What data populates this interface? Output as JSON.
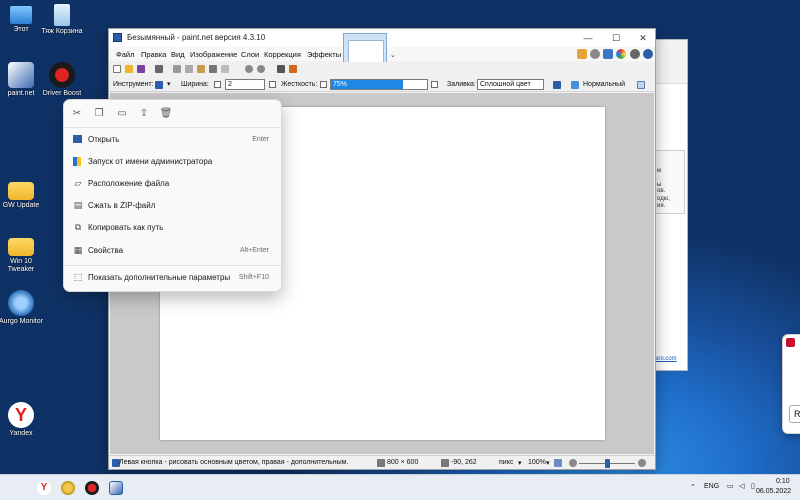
{
  "desktop": {
    "icons": [
      {
        "label": "Этот",
        "icon": "computer-icon"
      },
      {
        "label": "Тяж Корзина",
        "icon": "recycle-bin-icon"
      },
      {
        "label": "paint.net",
        "icon": "paintnet-icon"
      },
      {
        "label": "Driver Boost",
        "icon": "driver-booster-icon"
      },
      {
        "label": "GW Update",
        "icon": "folder-icon"
      },
      {
        "label": "Win 10 Tweaker",
        "icon": "folder-icon"
      },
      {
        "label": "Aurgo Monitor",
        "icon": "monitor-app-icon"
      },
      {
        "label": "Yandex",
        "icon": "yandex-browser-icon"
      }
    ]
  },
  "background_window": {
    "lines": [
      "м",
      "ы",
      "ов.",
      "одю,",
      "ия."
    ],
    "link": "aro.com"
  },
  "paintnet": {
    "title": "Безымянный - paint.net версия 4.3.10",
    "menu": [
      "Файл",
      "Правка",
      "Вид",
      "Изображение",
      "Слои",
      "Коррекция",
      "Эффекты"
    ],
    "toolbar": {
      "tool_label": "Инструмент:",
      "width_label": "Ширина:",
      "width_value": "2",
      "hardness_label": "Жесткость:",
      "hardness_value": "75%",
      "hardness_level": 0.75,
      "fill_label": "Заливка:",
      "fill_value": "Сплошной цвет",
      "blend_value": "Нормальный"
    },
    "status": {
      "hint": "Левая кнопка - рисовать основным цветом, правая - дополнительным.",
      "size": "800 × 600",
      "coords": "-90, 262",
      "units": "пикс",
      "zoom": "100%"
    }
  },
  "context_menu": {
    "quick_actions": [
      {
        "name": "cut",
        "icon": "cut-icon"
      },
      {
        "name": "copy",
        "icon": "copy-icon"
      },
      {
        "name": "rename",
        "icon": "rename-icon"
      },
      {
        "name": "share",
        "icon": "share-icon"
      },
      {
        "name": "delete",
        "icon": "delete-icon"
      }
    ],
    "items": [
      {
        "label": "Открыть",
        "shortcut": "Enter",
        "icon": "open-icon"
      },
      {
        "label": "Запуск от имени администратора",
        "shortcut": "",
        "icon": "admin-shield-icon"
      },
      {
        "label": "Расположение файла",
        "shortcut": "",
        "icon": "folder-icon"
      },
      {
        "label": "Сжать в ZIP-файл",
        "shortcut": "",
        "icon": "zip-icon"
      },
      {
        "label": "Копировать как путь",
        "shortcut": "",
        "icon": "copy-path-icon"
      },
      {
        "label": "Свойства",
        "shortcut": "Alt+Enter",
        "icon": "properties-icon"
      }
    ],
    "more": {
      "label": "Показать дополнительные параметры",
      "shortcut": "Shift+F10",
      "icon": "more-options-icon"
    }
  },
  "toast": {
    "button_letter": "R"
  },
  "taskbar": {
    "language": "ENG",
    "time": "0:10",
    "date": "06.05.2022"
  },
  "colors": {
    "accent": "#2a5ea8",
    "selection": "#1e88e5",
    "taskbar": "#e8edf3"
  }
}
